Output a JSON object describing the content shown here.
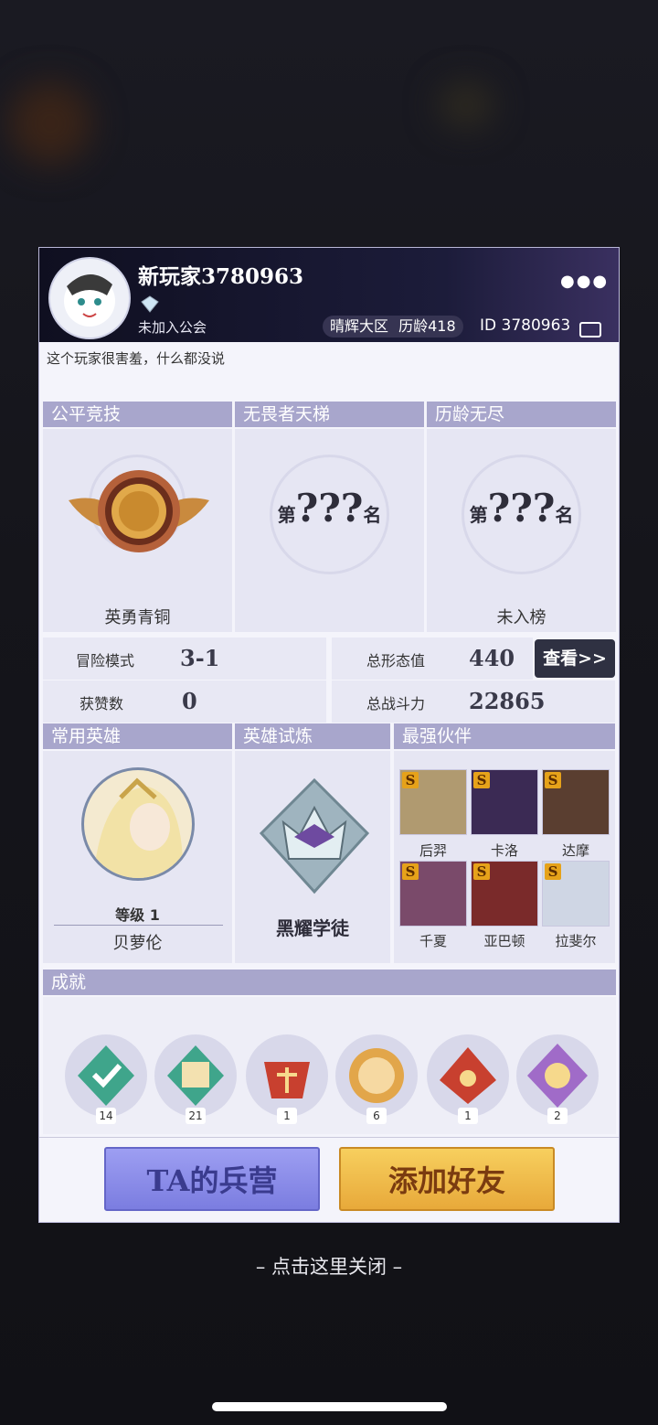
{
  "profile": {
    "name": "新玩家3780963",
    "guild": "未加入公会",
    "server": "晴辉大区",
    "age": "历龄418",
    "id": "ID 3780963",
    "signature": "这个玩家很害羞，什么都没说",
    "more_icon": "more-dots-icon"
  },
  "ranks": {
    "fair": {
      "title": "公平竞技",
      "label": "英勇青铜"
    },
    "ladder": {
      "title": "无畏者天梯",
      "prefix": "第",
      "value": "???",
      "suffix": "名"
    },
    "endless": {
      "title": "历龄无尽",
      "prefix": "第",
      "value": "???",
      "suffix": "名",
      "label": "未入榜"
    }
  },
  "stats": {
    "adventure_label": "冒险模式",
    "adventure_value": "3-1",
    "likes_label": "获赞数",
    "likes_value": "0",
    "form_label": "总形态值",
    "form_value": "440",
    "power_label": "总战斗力",
    "power_value": "22865",
    "view_label": "查看>>"
  },
  "hero": {
    "title": "常用英雄",
    "level": "等级 1",
    "name": "贝萝伦"
  },
  "trial": {
    "title": "英雄试炼",
    "label": "黑耀学徒"
  },
  "partners": {
    "title": "最强伙伴",
    "items": [
      {
        "name": "后羿",
        "grade": "S"
      },
      {
        "name": "卡洛",
        "grade": "S"
      },
      {
        "name": "达摩",
        "grade": "S"
      },
      {
        "name": "千夏",
        "grade": "S"
      },
      {
        "name": "亚巴顿",
        "grade": "S"
      },
      {
        "name": "拉斐尔",
        "grade": "S"
      }
    ]
  },
  "achievements": {
    "title": "成就",
    "items": [
      {
        "count": "14",
        "color": "#3fa58b"
      },
      {
        "count": "21",
        "color": "#3fa58b"
      },
      {
        "count": "1",
        "color": "#c8402f"
      },
      {
        "count": "6",
        "color": "#e2a64a"
      },
      {
        "count": "1",
        "color": "#c8402f"
      },
      {
        "count": "2",
        "color": "#a06bc8"
      }
    ]
  },
  "buttons": {
    "barracks": "TA的兵营",
    "add_friend": "添加好友"
  },
  "close_hint": "– 点击这里关闭 –"
}
